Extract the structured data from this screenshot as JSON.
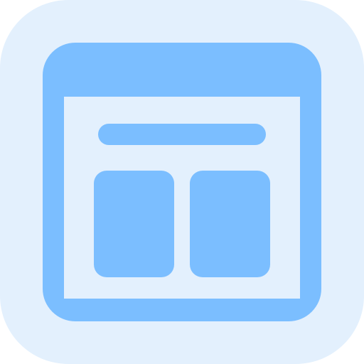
{
  "icon": {
    "name": "web-layout-icon",
    "colors": {
      "tile_background": "#E3F0FD",
      "frame": "#7BBEFF",
      "content_background": "#E3F0FD"
    }
  }
}
